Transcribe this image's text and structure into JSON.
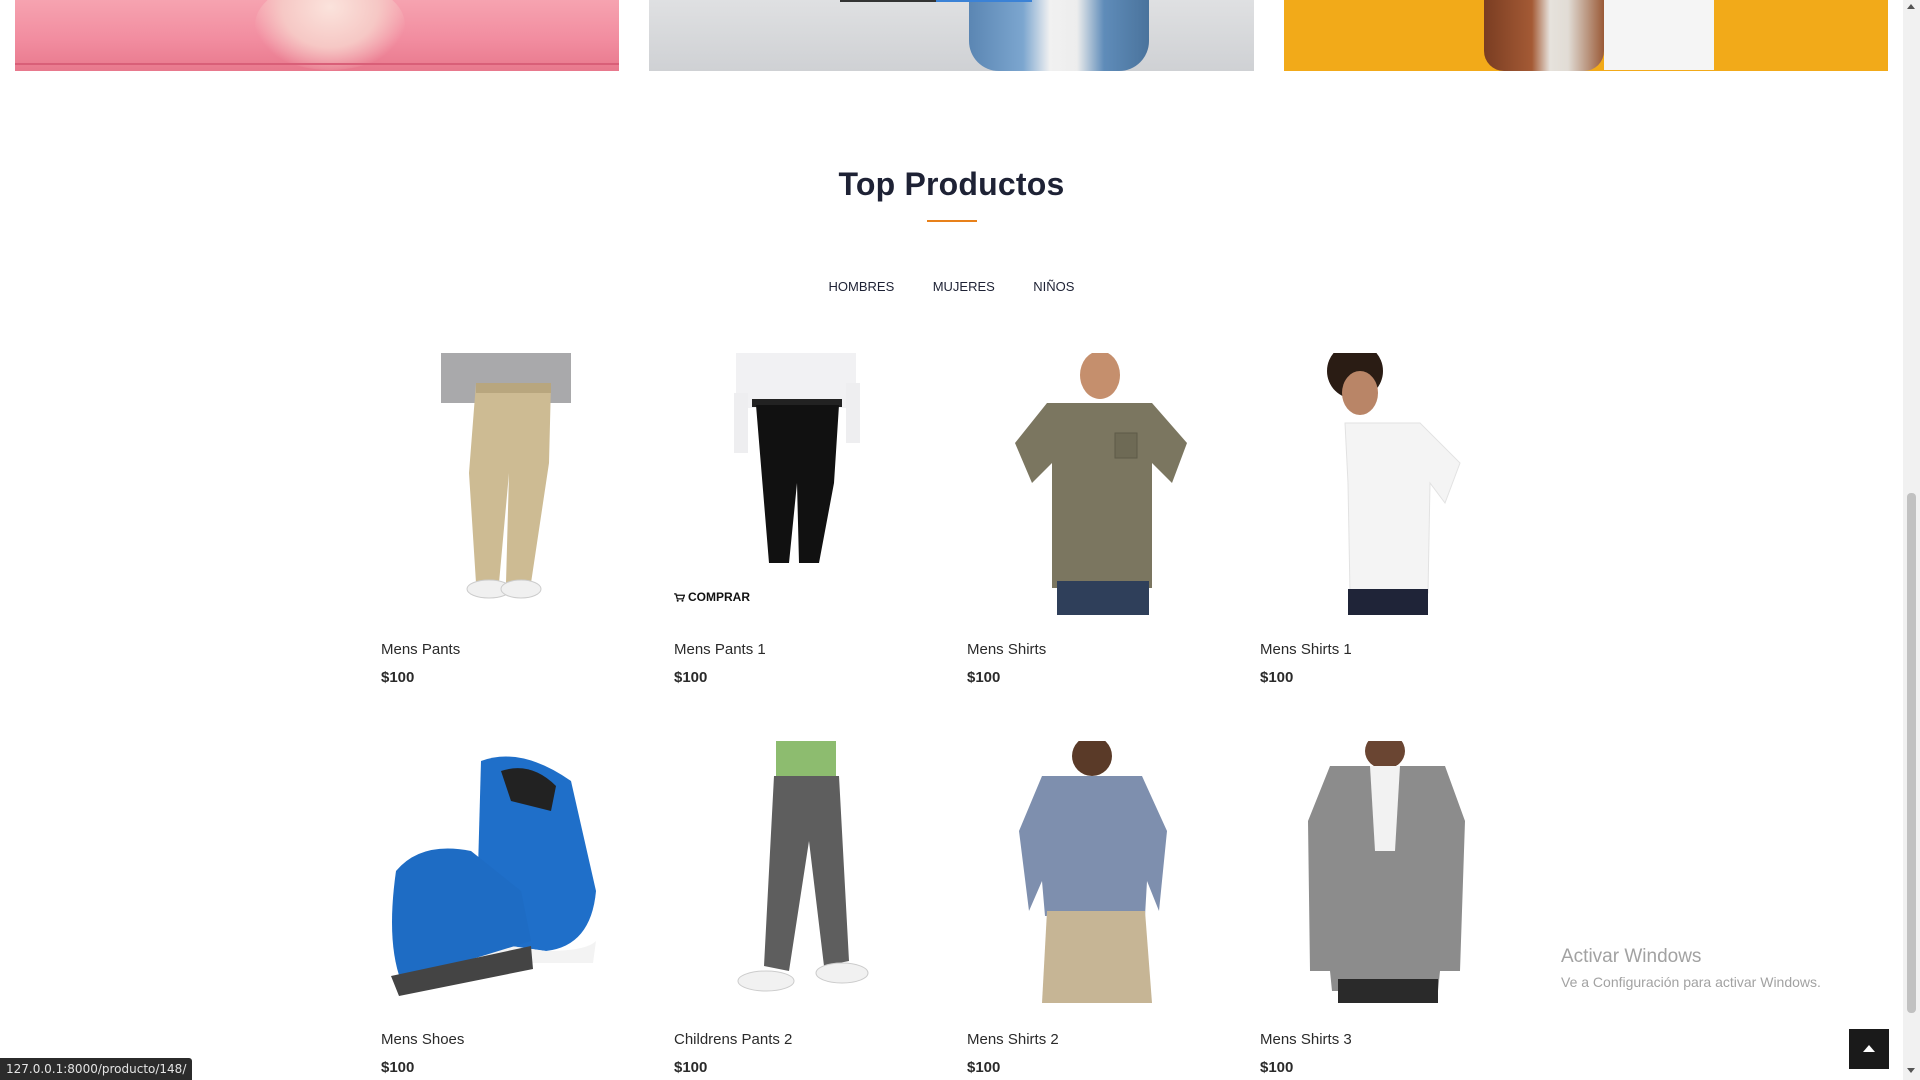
{
  "section": {
    "title": "Top Productos",
    "accent": "#e8811a"
  },
  "filters": [
    {
      "label": "HOMBRES"
    },
    {
      "label": "MUJERES"
    },
    {
      "label": "NIÑOS"
    }
  ],
  "products": [
    {
      "name": "Mens Pants",
      "price": "$100",
      "image": "khaki-pants"
    },
    {
      "name": "Mens Pants 1",
      "price": "$100",
      "image": "black-pants",
      "action": "COMPRAR"
    },
    {
      "name": "Mens Shirts",
      "price": "$100",
      "image": "olive-tshirt"
    },
    {
      "name": "Mens Shirts 1",
      "price": "$100",
      "image": "white-tshirt"
    },
    {
      "name": "Mens Shoes",
      "price": "$100",
      "image": "blue-sneakers"
    },
    {
      "name": "Childrens Pants 2",
      "price": "$100",
      "image": "grey-pants"
    },
    {
      "name": "Mens Shirts 2",
      "price": "$100",
      "image": "chambray-shirt"
    },
    {
      "name": "Mens Shirts 3",
      "price": "$100",
      "image": "grey-shirt"
    }
  ],
  "watermark": {
    "line1": "Activar Windows",
    "line2": "Ve a Configuración para activar Windows."
  },
  "status_url": "127.0.0.1:8000/producto/148/",
  "icons": {
    "cart": "cart-icon",
    "back_to_top": "chevron-up-icon"
  }
}
